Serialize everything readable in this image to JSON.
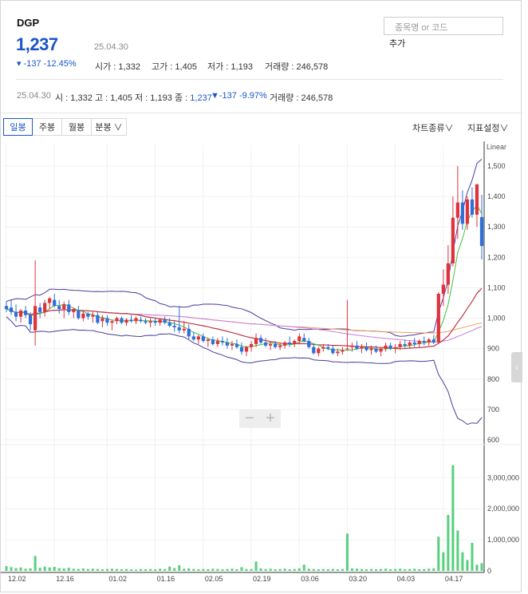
{
  "stock": {
    "name": "DGP",
    "price": "1,237",
    "change": "▾ -137 -12.45%",
    "date": "25.04.30",
    "open_label": "시가 : ",
    "open": "1,332",
    "high_label": "고가 : ",
    "high": "1,405",
    "low_label": "저가 : ",
    "low": "1,193",
    "volume_label": "거래량 : ",
    "volume": "246,578"
  },
  "search": {
    "placeholder": "종목명 or 코드",
    "add_label": "추가"
  },
  "summary": {
    "date": "25.04.30",
    "open": "시 : 1,332",
    "high": "고 : 1,405",
    "low": "저 : 1,193",
    "close_label": "종 : ",
    "close": "1,237",
    "change": "▼-137 -9.97%",
    "volume": "거래량 : 246,578"
  },
  "tabs": [
    {
      "label": "일봉",
      "active": true
    },
    {
      "label": "주봉",
      "active": false
    },
    {
      "label": "월봉",
      "active": false
    },
    {
      "label": "분봉 ∨",
      "active": false
    }
  ],
  "tools": {
    "chart_type": "차트종류∨",
    "indicator": "지표설정∨"
  },
  "zoom": {
    "minus": "−",
    "plus": "+"
  },
  "colors": {
    "up": "#e0323c",
    "down": "#2f6fd8",
    "volume": "#56d07d",
    "accent": "#1a56c9"
  },
  "chart_data": {
    "type": "candlestick",
    "scale_label": "Linear",
    "price_axis": {
      "ticks": [
        600,
        700,
        800,
        900,
        1000,
        1100,
        1200,
        1300,
        1400,
        1500
      ],
      "range": [
        600,
        1560
      ]
    },
    "volume_axis": {
      "ticks": [
        0,
        1000000,
        2000000,
        3000000
      ],
      "tick_labels": [
        "0",
        "1,000,000",
        "2,000,000",
        "3,000,000"
      ],
      "range": [
        0,
        3650000
      ]
    },
    "x_ticks": [
      {
        "label": "12.02",
        "index": 0
      },
      {
        "label": "12.16",
        "index": 10
      },
      {
        "label": "01.02",
        "index": 21
      },
      {
        "label": "01.16",
        "index": 31
      },
      {
        "label": "02.05",
        "index": 41
      },
      {
        "label": "02.19",
        "index": 51
      },
      {
        "label": "03.06",
        "index": 61
      },
      {
        "label": "03.20",
        "index": 71
      },
      {
        "label": "04.03",
        "index": 81
      },
      {
        "label": "04.17",
        "index": 91
      }
    ],
    "candles": [
      [
        1040,
        1055,
        1020,
        1030
      ],
      [
        1035,
        1060,
        1010,
        1020
      ],
      [
        1020,
        1045,
        990,
        1005
      ],
      [
        1005,
        1030,
        985,
        1025
      ],
      [
        1025,
        1040,
        1000,
        1010
      ],
      [
        1010,
        1020,
        960,
        980
      ],
      [
        960,
        1190,
        910,
        1040
      ],
      [
        1035,
        1050,
        1000,
        1020
      ],
      [
        1020,
        1060,
        1005,
        1050
      ],
      [
        1050,
        1070,
        1030,
        1065
      ],
      [
        1060,
        1080,
        1035,
        1040
      ],
      [
        1040,
        1060,
        1015,
        1030
      ],
      [
        1030,
        1055,
        1000,
        1045
      ],
      [
        1045,
        1060,
        1010,
        1020
      ],
      [
        1020,
        1035,
        1000,
        1030
      ],
      [
        1025,
        1040,
        995,
        1000
      ],
      [
        1000,
        1025,
        990,
        1015
      ],
      [
        1015,
        1020,
        995,
        1005
      ],
      [
        1005,
        1020,
        985,
        1010
      ],
      [
        1010,
        1020,
        980,
        985
      ],
      [
        990,
        1010,
        970,
        1000
      ],
      [
        1000,
        1010,
        975,
        985
      ],
      [
        985,
        995,
        960,
        990
      ],
      [
        990,
        1005,
        980,
        1000
      ],
      [
        1000,
        1005,
        980,
        985
      ],
      [
        985,
        1000,
        975,
        995
      ],
      [
        995,
        1010,
        985,
        990
      ],
      [
        990,
        1005,
        980,
        1000
      ],
      [
        995,
        1005,
        985,
        990
      ],
      [
        990,
        1000,
        980,
        985
      ],
      [
        985,
        1000,
        970,
        990
      ],
      [
        990,
        1000,
        975,
        985
      ],
      [
        985,
        1000,
        975,
        995
      ],
      [
        995,
        1005,
        980,
        985
      ],
      [
        985,
        1000,
        970,
        975
      ],
      [
        975,
        990,
        955,
        970
      ],
      [
        970,
        1040,
        950,
        960
      ],
      [
        960,
        990,
        950,
        965
      ],
      [
        965,
        980,
        930,
        940
      ],
      [
        940,
        955,
        925,
        930
      ],
      [
        930,
        945,
        915,
        940
      ],
      [
        940,
        950,
        920,
        925
      ],
      [
        925,
        935,
        905,
        930
      ],
      [
        930,
        940,
        910,
        915
      ],
      [
        915,
        935,
        905,
        925
      ],
      [
        925,
        940,
        910,
        920
      ],
      [
        920,
        935,
        900,
        910
      ],
      [
        910,
        925,
        895,
        915
      ],
      [
        915,
        930,
        900,
        905
      ],
      [
        905,
        920,
        880,
        890
      ],
      [
        890,
        910,
        875,
        905
      ],
      [
        905,
        925,
        890,
        915
      ],
      [
        915,
        950,
        905,
        935
      ],
      [
        935,
        945,
        915,
        920
      ],
      [
        920,
        935,
        905,
        910
      ],
      [
        910,
        925,
        895,
        915
      ],
      [
        915,
        925,
        900,
        905
      ],
      [
        905,
        920,
        895,
        910
      ],
      [
        910,
        925,
        900,
        920
      ],
      [
        920,
        940,
        905,
        915
      ],
      [
        915,
        930,
        905,
        925
      ],
      [
        925,
        950,
        915,
        940
      ],
      [
        935,
        950,
        920,
        925
      ],
      [
        925,
        935,
        900,
        905
      ],
      [
        905,
        915,
        880,
        885
      ],
      [
        885,
        905,
        875,
        900
      ],
      [
        900,
        915,
        890,
        905
      ],
      [
        905,
        915,
        895,
        900
      ],
      [
        900,
        910,
        880,
        885
      ],
      [
        885,
        900,
        875,
        890
      ],
      [
        890,
        905,
        880,
        895
      ],
      [
        900,
        1060,
        895,
        900
      ],
      [
        905,
        920,
        890,
        910
      ],
      [
        910,
        925,
        895,
        900
      ],
      [
        900,
        915,
        885,
        905
      ],
      [
        905,
        920,
        890,
        895
      ],
      [
        895,
        910,
        880,
        900
      ],
      [
        900,
        910,
        885,
        890
      ],
      [
        890,
        905,
        875,
        900
      ],
      [
        900,
        920,
        890,
        910
      ],
      [
        910,
        920,
        895,
        900
      ],
      [
        900,
        915,
        885,
        905
      ],
      [
        905,
        925,
        895,
        915
      ],
      [
        915,
        930,
        900,
        910
      ],
      [
        910,
        925,
        900,
        920
      ],
      [
        920,
        935,
        905,
        915
      ],
      [
        915,
        930,
        905,
        925
      ],
      [
        925,
        940,
        910,
        920
      ],
      [
        920,
        935,
        910,
        930
      ],
      [
        930,
        945,
        915,
        920
      ],
      [
        920,
        1085,
        915,
        1080
      ],
      [
        1080,
        1160,
        1040,
        1110
      ],
      [
        1110,
        1240,
        1080,
        1180
      ],
      [
        1180,
        1400,
        1170,
        1330
      ],
      [
        1330,
        1500,
        1260,
        1380
      ],
      [
        1380,
        1420,
        1290,
        1310
      ],
      [
        1310,
        1400,
        1290,
        1390
      ],
      [
        1390,
        1430,
        1330,
        1340
      ],
      [
        1340,
        1440,
        1300,
        1440
      ],
      [
        1332,
        1405,
        1193,
        1237
      ]
    ],
    "volume": [
      150000,
      120000,
      90000,
      110000,
      70000,
      80000,
      480000,
      100000,
      140000,
      110000,
      130000,
      90000,
      80000,
      100000,
      70000,
      60000,
      80000,
      60000,
      70000,
      60000,
      50000,
      60000,
      70000,
      60000,
      50000,
      60000,
      50000,
      40000,
      60000,
      50000,
      60000,
      50000,
      70000,
      60000,
      140000,
      90000,
      180000,
      70000,
      80000,
      60000,
      50000,
      60000,
      50000,
      70000,
      60000,
      50000,
      60000,
      70000,
      50000,
      120000,
      60000,
      60000,
      300000,
      80000,
      60000,
      70000,
      50000,
      60000,
      70000,
      50000,
      60000,
      80000,
      200000,
      70000,
      60000,
      50000,
      60000,
      50000,
      60000,
      50000,
      60000,
      1200000,
      80000,
      70000,
      60000,
      50000,
      60000,
      50000,
      60000,
      70000,
      50000,
      60000,
      70000,
      50000,
      60000,
      70000,
      50000,
      60000,
      70000,
      80000,
      1100000,
      600000,
      1800000,
      3400000,
      1300000,
      600000,
      350000,
      900000,
      200000,
      246578
    ],
    "ma_lines": [
      {
        "name": "MA5",
        "color": "#3fbf3f"
      },
      {
        "name": "MA20",
        "color": "#c13848"
      },
      {
        "name": "MA60",
        "color": "#c77de0"
      },
      {
        "name": "MA120",
        "color": "#f0a35a"
      }
    ],
    "bollinger_color": "#4b3b9e"
  }
}
